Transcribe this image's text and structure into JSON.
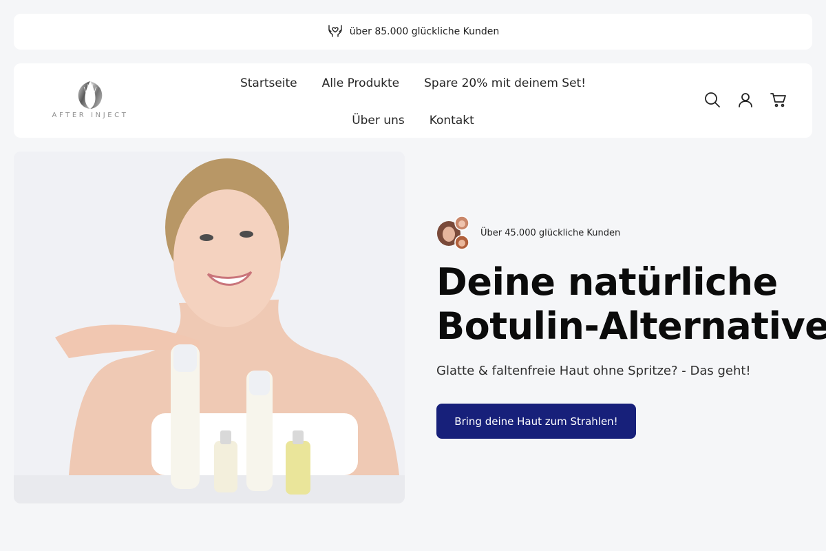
{
  "announcement": {
    "text": "über 85.000 glückliche Kunden",
    "icon": "heart-hands-icon"
  },
  "header": {
    "logo_text": "AFTER INJECT",
    "nav": [
      {
        "label": "Startseite"
      },
      {
        "label": "Alle Produkte"
      },
      {
        "label": "Spare 20% mit deinem Set!"
      },
      {
        "label": "Über uns"
      },
      {
        "label": "Kontakt"
      }
    ],
    "icons": [
      "search-icon",
      "account-icon",
      "cart-icon"
    ]
  },
  "hero": {
    "social_proof": "Über 45.000 glückliche Kunden",
    "headline_line1": "Deine natürliche",
    "headline_line2": "Botulin-Alternative",
    "subline": "Glatte & faltenfreie Haut ohne Spritze? - Das geht!",
    "cta_label": "Bring deine Haut zum Strahlen!"
  },
  "colors": {
    "background": "#f5f6f8",
    "cta": "#17207a",
    "card": "#ffffff"
  }
}
